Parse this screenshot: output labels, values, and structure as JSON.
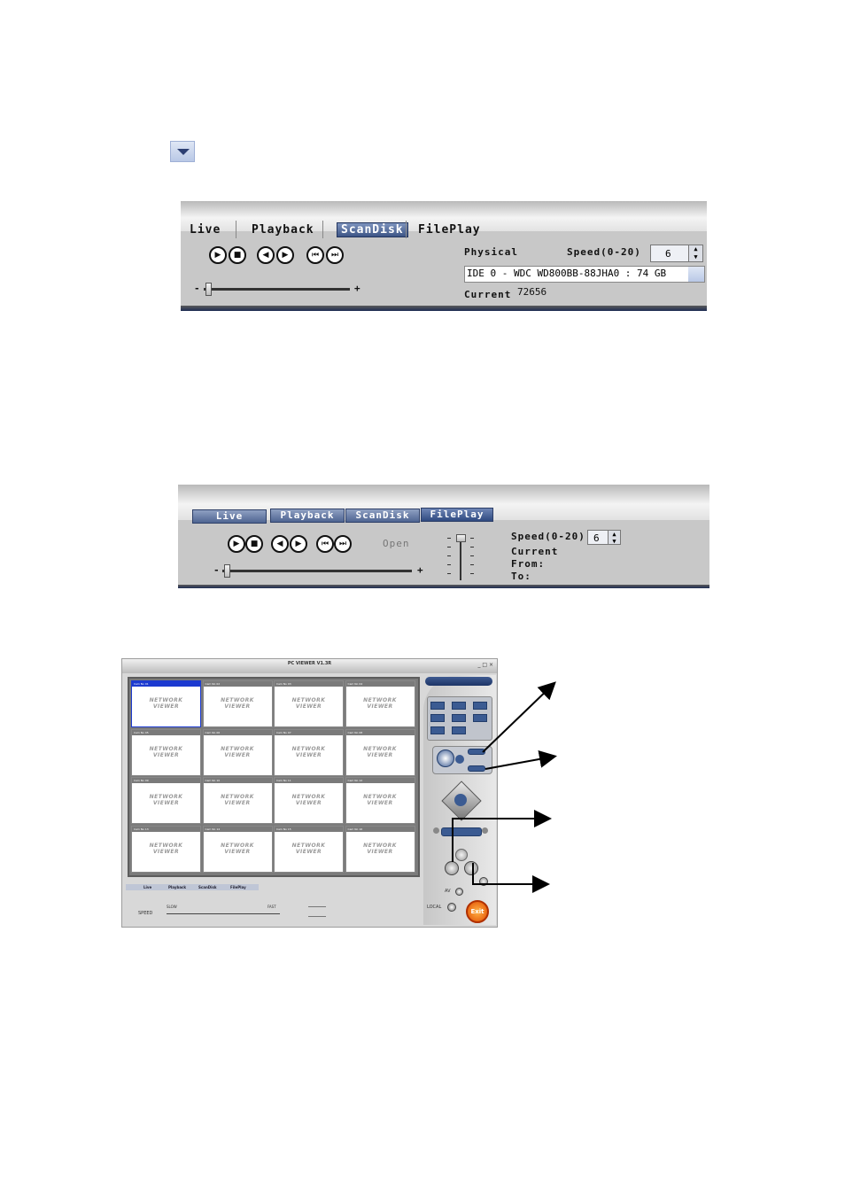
{
  "panel1": {
    "tabs": [
      "Live",
      "Playback",
      "ScanDisk",
      "FilePlay"
    ],
    "active_tab": "ScanDisk",
    "physical_label": "Physical",
    "speed_label": "Speed(0-20)",
    "speed_value": "6",
    "disk_value": "IDE 0 - WDC WD800BB-88JHA0 : 74 GB",
    "current_label": "Current",
    "current_value": "72656",
    "slider_minus": "-",
    "slider_plus": "+"
  },
  "panel2": {
    "tabs": [
      "Live",
      "Playback",
      "ScanDisk",
      "FilePlay"
    ],
    "active_tab": "FilePlay",
    "open_label": "Open",
    "speed_label": "Speed(0-20)",
    "speed_value": "6",
    "current_label": "Current",
    "from_label": "From:",
    "to_label": "To:",
    "slider_minus": "-",
    "slider_plus": "+"
  },
  "viewer": {
    "title": "PC VIEWER V1.3R",
    "camera_labels": [
      "Cam No 01",
      "Cam No 02",
      "Cam No 03",
      "Cam No 04",
      "Cam No 05",
      "Cam No 06",
      "Cam No 07",
      "Cam No 08",
      "Cam No 09",
      "Cam No 10",
      "Cam No 11",
      "Cam No 12",
      "Cam No 13",
      "Cam No 14",
      "Cam No 15",
      "Cam No 16"
    ],
    "logo_line1": "NETWORK",
    "logo_line2": "VIEWER",
    "tabs": [
      "Live",
      "Playback",
      "ScanDisk",
      "FilePlay"
    ],
    "speed_label": "SPEED",
    "slow_label": "SLOW",
    "fast_label": "FAST",
    "av_label": "AV",
    "local_label": "LOCAL",
    "exit_label": "Exit"
  },
  "icons": {
    "dropdown": "chevron-down-icon",
    "play": "play-icon",
    "stop": "stop-icon",
    "prev": "step-back-icon",
    "next": "step-forward-icon",
    "first": "skip-first-icon",
    "last": "skip-last-icon"
  }
}
